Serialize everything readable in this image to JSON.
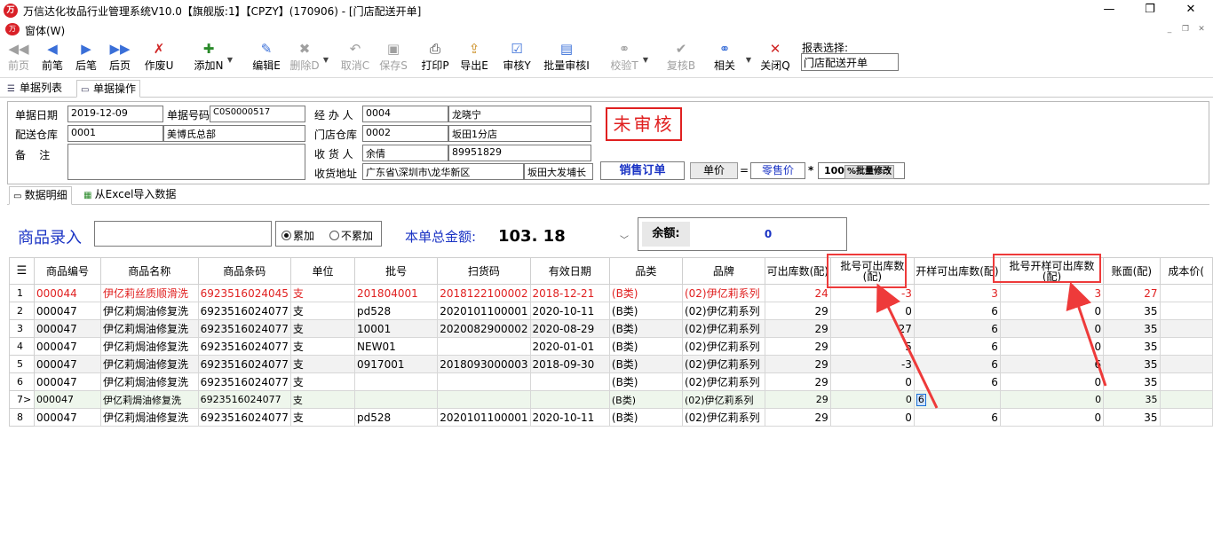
{
  "window": {
    "title": "万信达化妆品行业管理系统V10.0【旗舰版:1】【CPZY】(170906) - [门店配送开单]",
    "logo_text": "万"
  },
  "menu": {
    "window_label": "窗体(W)"
  },
  "toolbar": {
    "items": [
      {
        "label": "前页",
        "icon": "◀◀"
      },
      {
        "label": "前笔",
        "icon": "◀"
      },
      {
        "label": "后笔",
        "icon": "▶"
      },
      {
        "label": "后页",
        "icon": "▶▶"
      },
      {
        "label": "作废U",
        "icon": "✗"
      },
      {
        "label": "添加N",
        "icon": "✚"
      },
      {
        "label": "编辑E",
        "icon": "✎"
      },
      {
        "label": "删除D",
        "icon": "✖"
      },
      {
        "label": "取消C",
        "icon": "↶"
      },
      {
        "label": "保存S",
        "icon": "▣"
      },
      {
        "label": "打印P",
        "icon": "⎙"
      },
      {
        "label": "导出E",
        "icon": "⇪"
      },
      {
        "label": "审核Y",
        "icon": "☑"
      },
      {
        "label": "批量审核I",
        "icon": "▤"
      },
      {
        "label": "校验T",
        "icon": "⚭"
      },
      {
        "label": "复核B",
        "icon": "✔"
      },
      {
        "label": "相关",
        "icon": "⚭"
      },
      {
        "label": "关闭Q",
        "icon": "✕"
      }
    ],
    "report_label": "报表选择:",
    "report_value": "门店配送开单"
  },
  "tabs": {
    "list": "单据列表",
    "operate": "单据操作"
  },
  "form": {
    "date_label": "单据日期",
    "date": "2019-12-09",
    "no_label": "单据号码",
    "no": "C0S0000517",
    "handler_label": "经 办 人",
    "handler_code": "0004",
    "handler_name": "龙晓宁",
    "wh_label": "配送仓库",
    "wh_code": "0001",
    "wh_name": "美博氏总部",
    "store_label": "门店仓库",
    "store_code": "0002",
    "store_name": "坂田1分店",
    "note_label": "备    注",
    "note": "",
    "receiver_label": "收 货 人",
    "receiver": "余倩",
    "phone": "89951829",
    "addr_label": "收货地址",
    "addr1": "广东省\\深圳市\\龙华新区",
    "addr2": "坂田大发埔长"
  },
  "status": "未审核",
  "pricing": {
    "order_type": "销售订单",
    "unit_price": "单价",
    "eq": "=",
    "price_type": "零售价",
    "star": "*",
    "pct": "100",
    "batch_edit": "%批量修改"
  },
  "detail_tabs": {
    "detail": "数据明细",
    "excel": "从Excel导入数据"
  },
  "entry": {
    "label": "商品录入",
    "accumulate": "累加",
    "no_accumulate": "不累加",
    "total_label": "本单总金额:",
    "total": "103. 18",
    "balance_label": "余额:",
    "balance": "0"
  },
  "grid": {
    "columns": [
      "商品编号",
      "商品名称",
      "商品条码",
      "单位",
      "批号",
      "扫货码",
      "有效日期",
      "品类",
      "品牌",
      "可出库数(配)",
      "批号可出库数(配)",
      "开样可出库数(配)",
      "批号开样可出库数(配)",
      "账面(配)",
      "成本价("
    ],
    "rows": [
      {
        "rn": "1",
        "cells": [
          "000044",
          "伊亿莉丝质顺滑洗",
          "6923516024045",
          "支",
          "201804001",
          "2018122100002",
          "2018-12-21",
          "(B类)",
          "(02)伊亿莉系列",
          "24",
          "-3",
          "3",
          "3",
          "27",
          ""
        ]
      },
      {
        "rn": "2",
        "cells": [
          "000047",
          "伊亿莉焗油修复洗",
          "6923516024077",
          "支",
          "pd528",
          "2020101100001",
          "2020-10-11",
          "(B类)",
          "(02)伊亿莉系列",
          "29",
          "0",
          "6",
          "0",
          "35",
          ""
        ]
      },
      {
        "rn": "3",
        "cells": [
          "000047",
          "伊亿莉焗油修复洗",
          "6923516024077",
          "支",
          "10001",
          "2020082900002",
          "2020-08-29",
          "(B类)",
          "(02)伊亿莉系列",
          "29",
          "27",
          "6",
          "0",
          "35",
          ""
        ]
      },
      {
        "rn": "4",
        "cells": [
          "000047",
          "伊亿莉焗油修复洗",
          "6923516024077",
          "支",
          "NEW01",
          "",
          "2020-01-01",
          "(B类)",
          "(02)伊亿莉系列",
          "29",
          "5",
          "6",
          "0",
          "35",
          ""
        ]
      },
      {
        "rn": "5",
        "cells": [
          "000047",
          "伊亿莉焗油修复洗",
          "6923516024077",
          "支",
          "0917001",
          "2018093000003",
          "2018-09-30",
          "(B类)",
          "(02)伊亿莉系列",
          "29",
          "-3",
          "6",
          "6",
          "35",
          ""
        ]
      },
      {
        "rn": "6",
        "cells": [
          "000047",
          "伊亿莉焗油修复洗",
          "6923516024077",
          "支",
          "",
          "",
          "",
          "(B类)",
          "(02)伊亿莉系列",
          "29",
          "0",
          "6",
          "0",
          "35",
          ""
        ]
      },
      {
        "rn": "7>",
        "cells": [
          "000047",
          "伊亿莉焗油修复洗",
          "6923516024077",
          "支",
          "",
          "",
          "",
          "(B类)",
          "(02)伊亿莉系列",
          "29",
          "0",
          "6",
          "0",
          "35",
          ""
        ]
      },
      {
        "rn": "8",
        "cells": [
          "000047",
          "伊亿莉焗油修复洗",
          "6923516024077",
          "支",
          "pd528",
          "2020101100001",
          "2020-10-11",
          "(B类)",
          "(02)伊亿莉系列",
          "29",
          "0",
          "6",
          "0",
          "35",
          ""
        ]
      }
    ]
  }
}
